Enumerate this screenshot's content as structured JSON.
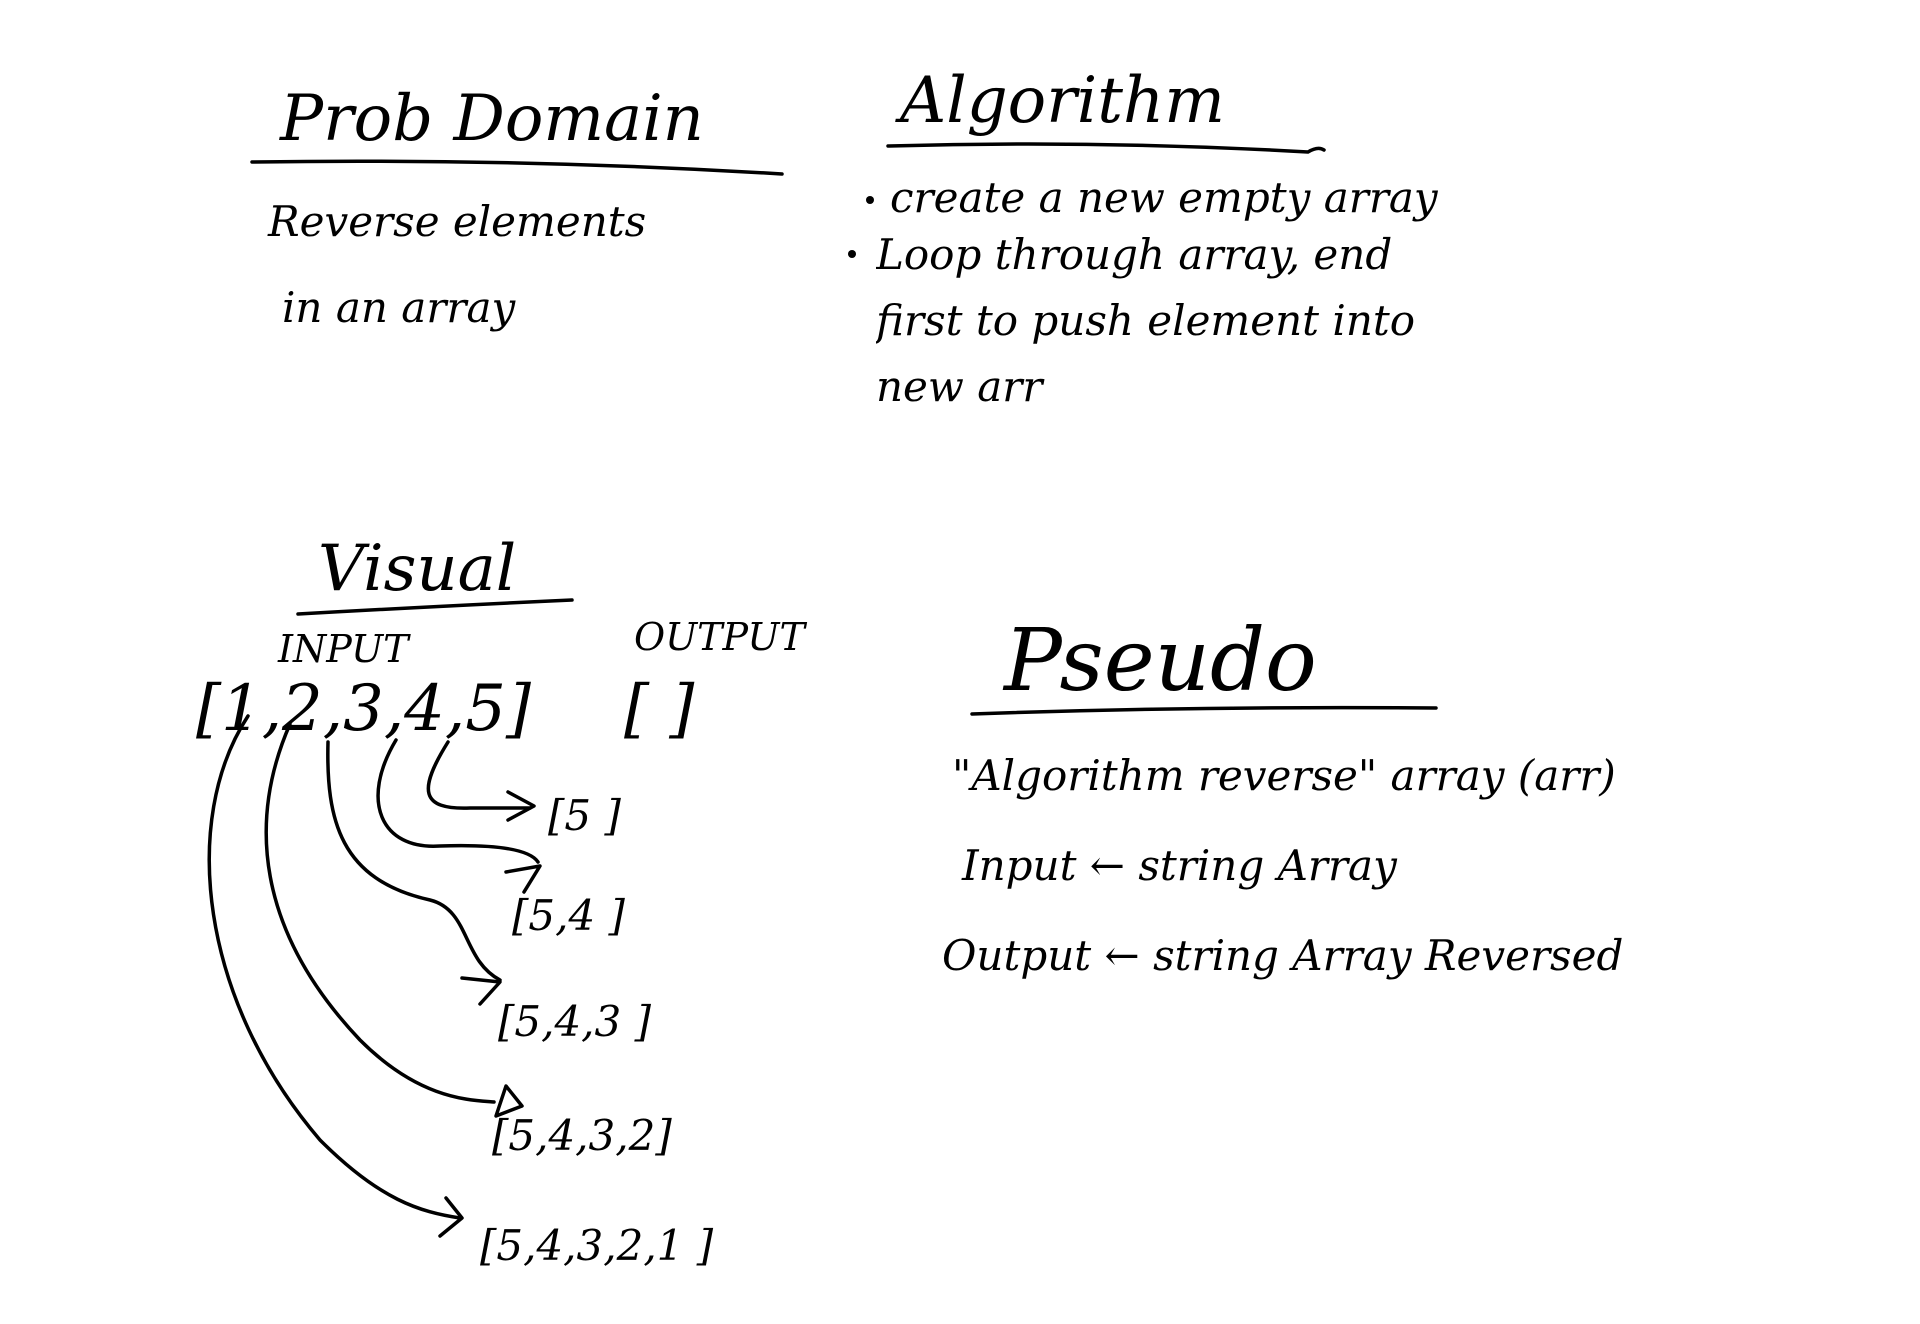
{
  "problem_domain": {
    "heading": "Prob Domain",
    "lines": [
      "Reverse elements",
      "in an array"
    ]
  },
  "algorithm": {
    "heading": "Algorithm",
    "bullets": [
      "create a new empty array",
      "Loop through array, end first to push element into new arr"
    ]
  },
  "visual": {
    "heading": "Visual",
    "input_label": "INPUT",
    "output_label": "OUTPUT",
    "input_array": "[1,2,3,4,5]",
    "output_empty": "[ ]",
    "steps": [
      "[5 ]",
      "[5,4 ]",
      "[5,4,3 ]",
      "[5,4,3,2]",
      "[5,4,3,2,1 ]"
    ]
  },
  "pseudo": {
    "heading": "Pseudo",
    "lines": [
      "\"Algorithm reverse\" array (arr)",
      "Input ← string Array",
      "Output ← string Array Reversed"
    ]
  }
}
